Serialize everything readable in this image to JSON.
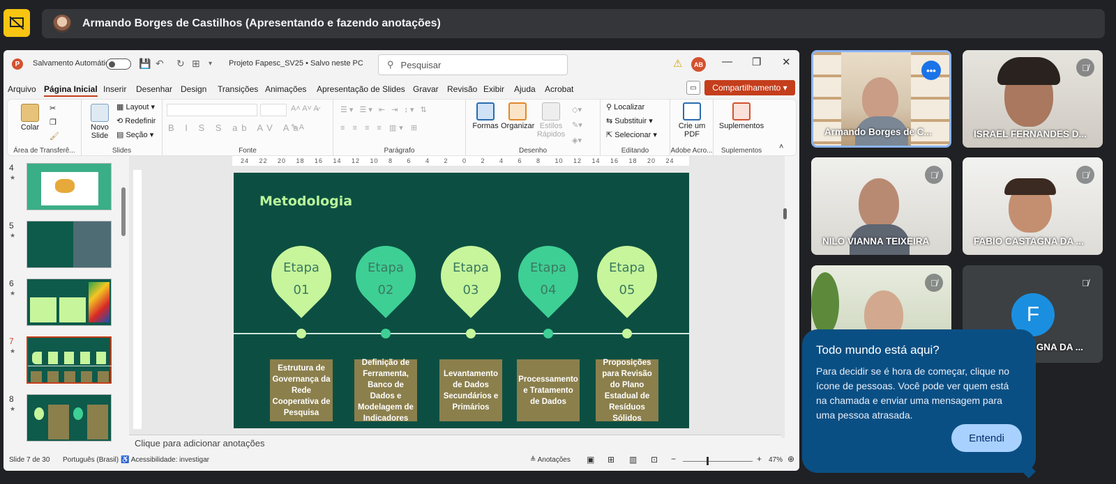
{
  "meet": {
    "presenter_banner": "Armando Borges de Castilhos (Apresentando e fazendo anotações)"
  },
  "ppt": {
    "autosave_label": "Salvamento Automático",
    "filename": "Projeto Fapesc_SV25 • Salvo neste PC",
    "search_placeholder": "Pesquisar",
    "user_initials": "AB",
    "menu": [
      "Arquivo",
      "Página Inicial",
      "Inserir",
      "Desenhar",
      "Design",
      "Transições",
      "Animações",
      "Apresentação de Slides",
      "Gravar",
      "Revisão",
      "Exibir",
      "Ajuda",
      "Acrobat"
    ],
    "share_label": "Compartilhamento",
    "ribbon": {
      "colar": "Colar",
      "clipboard_group": "Área de Transferê...",
      "novo_slide": "Novo",
      "novo_slide2": "Slide",
      "layout": "Layout",
      "redefinir": "Redefinir",
      "secao": "Seção",
      "slides_group": "Slides",
      "fonte_group": "Fonte",
      "paragrafo_group": "Parágrafo",
      "formas": "Formas",
      "organizar": "Organizar",
      "estilos": "Estilos",
      "estilos2": "Rápidos",
      "desenho_group": "Desenho",
      "localizar": "Localizar",
      "substituir": "Substituir",
      "selecionar": "Selecionar",
      "editando_group": "Editando",
      "crie_pdf": "Crie um",
      "crie_pdf2": "PDF",
      "adobe_group": "Adobe Acro...",
      "suplementos": "Suplementos",
      "suplementos_group": "Suplementos"
    },
    "thumbnails": [
      {
        "num": "4"
      },
      {
        "num": "5"
      },
      {
        "num": "6"
      },
      {
        "num": "7"
      },
      {
        "num": "8"
      }
    ],
    "slide": {
      "title": "Metodologia",
      "stages": [
        {
          "label": "Etapa",
          "num": "01",
          "text": "Estrutura de Governança da Rede Cooperativa de Pesquisa",
          "color": "#c7f59b"
        },
        {
          "label": "Etapa",
          "num": "02",
          "text": "Definição de Ferramenta, Banco de Dados e Modelagem de Indicadores",
          "color": "#3ecf95"
        },
        {
          "label": "Etapa",
          "num": "03",
          "text": "Levantamento de Dados Secundários e Primários",
          "color": "#c7f59b"
        },
        {
          "label": "Etapa",
          "num": "04",
          "text": "Processamento e Tratamento de Dados",
          "color": "#3ecf95"
        },
        {
          "label": "Etapa",
          "num": "05",
          "text": "Proposições para Revisão do Plano Estadual de Resíduos Sólidos",
          "color": "#c7f59b"
        }
      ]
    },
    "notes_placeholder": "Clique para adicionar anotações",
    "status": {
      "slide": "Slide 7 de 30",
      "language": "Português (Brasil)",
      "accessibility": "Acessibilidade: investigar",
      "notes_btn": "Anotações",
      "zoom": "47%"
    }
  },
  "participants": [
    {
      "name": "Armando Borges de C..."
    },
    {
      "name": "ISRAEL FERNANDES D..."
    },
    {
      "name": "NILO VIANNA TEIXEIRA"
    },
    {
      "name": "FABIO CASTAGNA DA ..."
    },
    {
      "name": ""
    },
    {
      "name": "AGNA DA ...",
      "initial": "F"
    }
  ],
  "tooltip": {
    "title": "Todo mundo está aqui?",
    "body": "Para decidir se é hora de começar, clique no ícone de pessoas. Você pode ver quem está na chamada e enviar uma mensagem para uma pessoa atrasada.",
    "button": "Entendi"
  }
}
